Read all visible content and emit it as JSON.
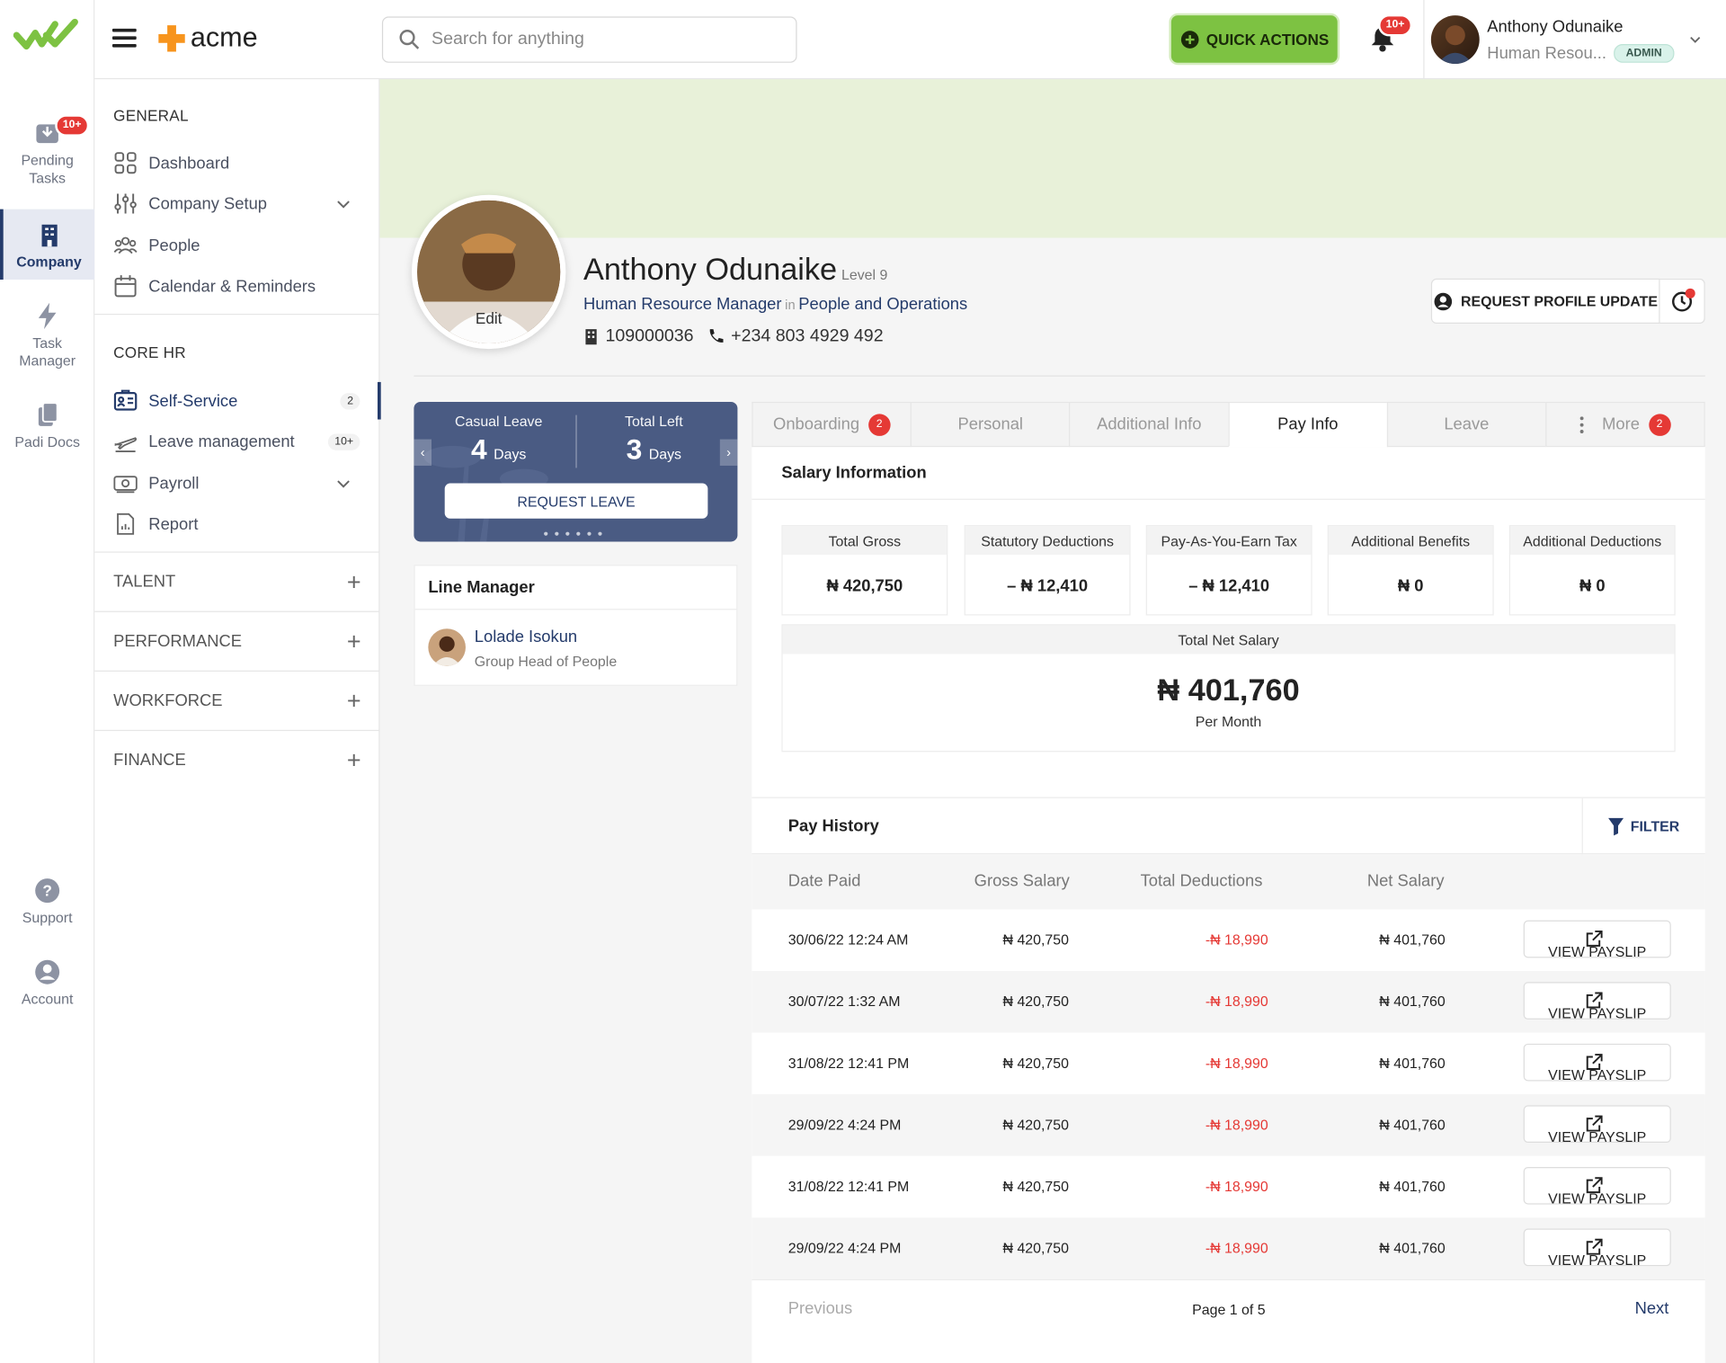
{
  "app": {
    "brand": "acme",
    "brand_accent": "#f7941d",
    "primary": "#243b6b",
    "green": "#7dc242"
  },
  "rail": {
    "items": [
      {
        "label": "Pending Tasks",
        "badge": "10+"
      },
      {
        "label": "Company"
      },
      {
        "label": "Task Manager"
      },
      {
        "label": "Padi Docs"
      },
      {
        "label": "Support"
      },
      {
        "label": "Account"
      }
    ]
  },
  "topbar": {
    "search_placeholder": "Search for anything",
    "quick_actions": "QUICK ACTIONS",
    "notif_badge": "10+",
    "user_name": "Anthony Odunaike",
    "user_role": "Human Resou...",
    "user_badge": "ADMIN"
  },
  "sidebar": {
    "general_title": "GENERAL",
    "general": [
      {
        "label": "Dashboard"
      },
      {
        "label": "Company Setup"
      },
      {
        "label": "People"
      },
      {
        "label": "Calendar & Reminders"
      }
    ],
    "core_title": "CORE HR",
    "core": [
      {
        "label": "Self-Service",
        "count": "2"
      },
      {
        "label": "Leave management",
        "count": "10+"
      },
      {
        "label": "Payroll"
      },
      {
        "label": "Report"
      }
    ],
    "groups": [
      "TALENT",
      "PERFORMANCE",
      "WORKFORCE",
      "FINANCE"
    ]
  },
  "profile": {
    "edit": "Edit",
    "name": "Anthony Odunaike",
    "level": "Level 9",
    "title": "Human Resource Manager",
    "in": "in",
    "department": "People and Operations",
    "staff_id": "109000036",
    "phone": "+234 803 4929 492",
    "request_update": "REQUEST PROFILE UPDATE"
  },
  "leave_card": {
    "casual_label": "Casual Leave",
    "casual_value": "4",
    "left_label": "Total Left",
    "left_value": "3",
    "unit": "Days",
    "button": "REQUEST LEAVE"
  },
  "line_manager": {
    "heading": "Line Manager",
    "name": "Lolade Isokun",
    "title": "Group Head of People"
  },
  "tabs": [
    {
      "label": "Onboarding",
      "badge": "2"
    },
    {
      "label": "Personal"
    },
    {
      "label": "Additional Info"
    },
    {
      "label": "Pay Info",
      "active": true
    },
    {
      "label": "Leave"
    },
    {
      "label": "More",
      "badge": "2"
    }
  ],
  "salary": {
    "heading": "Salary Information",
    "cells": [
      {
        "label": "Total Gross",
        "value": "₦ 420,750"
      },
      {
        "label": "Statutory Deductions",
        "value": "– ₦ 12,410"
      },
      {
        "label": "Pay-As-You-Earn Tax",
        "value": "– ₦ 12,410"
      },
      {
        "label": "Additional Benefits",
        "value": "₦ 0"
      },
      {
        "label": "Additional Deductions",
        "value": "₦ 0"
      }
    ],
    "net_label": "Total Net Salary",
    "net_value": "₦ 401,760",
    "net_period": "Per Month"
  },
  "pay_history": {
    "heading": "Pay History",
    "filter": "FILTER",
    "columns": [
      "Date Paid",
      "Gross Salary",
      "Total Deductions",
      "Net Salary"
    ],
    "action_label": "VIEW PAYSLIP",
    "rows": [
      {
        "date": "30/06/22 12:24 AM",
        "gross": "₦ 420,750",
        "deductions": "-₦ 18,990",
        "net": "₦ 401,760"
      },
      {
        "date": "30/07/22 1:32 AM",
        "gross": "₦ 420,750",
        "deductions": "-₦ 18,990",
        "net": "₦ 401,760"
      },
      {
        "date": "31/08/22 12:41 PM",
        "gross": "₦ 420,750",
        "deductions": "-₦ 18,990",
        "net": "₦ 401,760"
      },
      {
        "date": "29/09/22 4:24 PM",
        "gross": "₦ 420,750",
        "deductions": "-₦ 18,990",
        "net": "₦ 401,760"
      },
      {
        "date": "31/08/22 12:41 PM",
        "gross": "₦ 420,750",
        "deductions": "-₦ 18,990",
        "net": "₦ 401,760"
      },
      {
        "date": "29/09/22 4:24 PM",
        "gross": "₦ 420,750",
        "deductions": "-₦ 18,990",
        "net": "₦ 401,760"
      }
    ],
    "previous": "Previous",
    "page_info": "Page 1 of 5",
    "next": "Next"
  }
}
